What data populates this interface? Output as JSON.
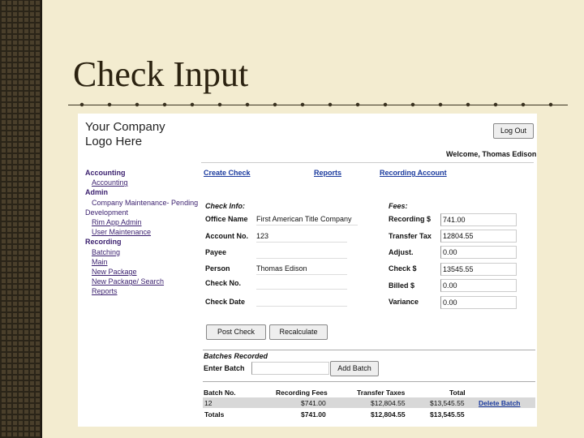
{
  "slide": {
    "title": "Check Input"
  },
  "app": {
    "logo_line1": "Your Company",
    "logo_line2": "Logo Here",
    "logout_label": "Log Out",
    "welcome": "Welcome, Thomas Edison"
  },
  "nav": {
    "accounting": "Accounting",
    "accounting_link": "Accounting",
    "admin": "Admin",
    "pending": "Company Maintenance- Pending",
    "development": "Development",
    "rim_admin": "Rim App Admin",
    "user_maint": "User Maintenance",
    "recording": "Recording",
    "batching": "Batching",
    "main": "Main",
    "new_package": "New Package",
    "new_package_search": "New Package/ Search",
    "reports": "Reports"
  },
  "toplinks": {
    "create_check": "Create Check",
    "reports": "Reports",
    "recording_account": "Recording Account"
  },
  "check": {
    "section": "Check Info:",
    "office_name_label": "Office Name",
    "office_name": "First American Title Company",
    "account_no_label": "Account No.",
    "account_no": "123",
    "payee_label": "Payee",
    "payee": "",
    "person_label": "Person",
    "person": "Thomas Edison",
    "check_no_label": "Check No.",
    "check_no": "",
    "check_date_label": "Check Date",
    "check_date": ""
  },
  "fees": {
    "section": "Fees:",
    "recording_label": "Recording $",
    "recording": "741.00",
    "transfer_label": "Transfer Tax",
    "transfer": "12804.55",
    "adjust_label": "Adjust.",
    "adjust": "0.00",
    "check_label": "Check $",
    "check": "13545.55",
    "billed_label": "Billed $",
    "billed": "0.00",
    "variance_label": "Variance",
    "variance": "0.00"
  },
  "buttons": {
    "post_check": "Post Check",
    "recalculate": "Recalculate",
    "add_batch": "Add Batch"
  },
  "batches": {
    "section": "Batches Recorded",
    "enter_label": "Enter Batch",
    "enter_value": "",
    "headers": [
      "Batch No.",
      "Recording Fees",
      "Transfer Taxes",
      "Total"
    ],
    "row": {
      "batch": "12",
      "fees": "$741.00",
      "taxes": "$12,804.55",
      "total": "$13,545.55",
      "action": "Delete Batch"
    },
    "totals": {
      "label": "Totals",
      "fees": "$741.00",
      "taxes": "$12,804.55",
      "total": "$13,545.55"
    }
  }
}
